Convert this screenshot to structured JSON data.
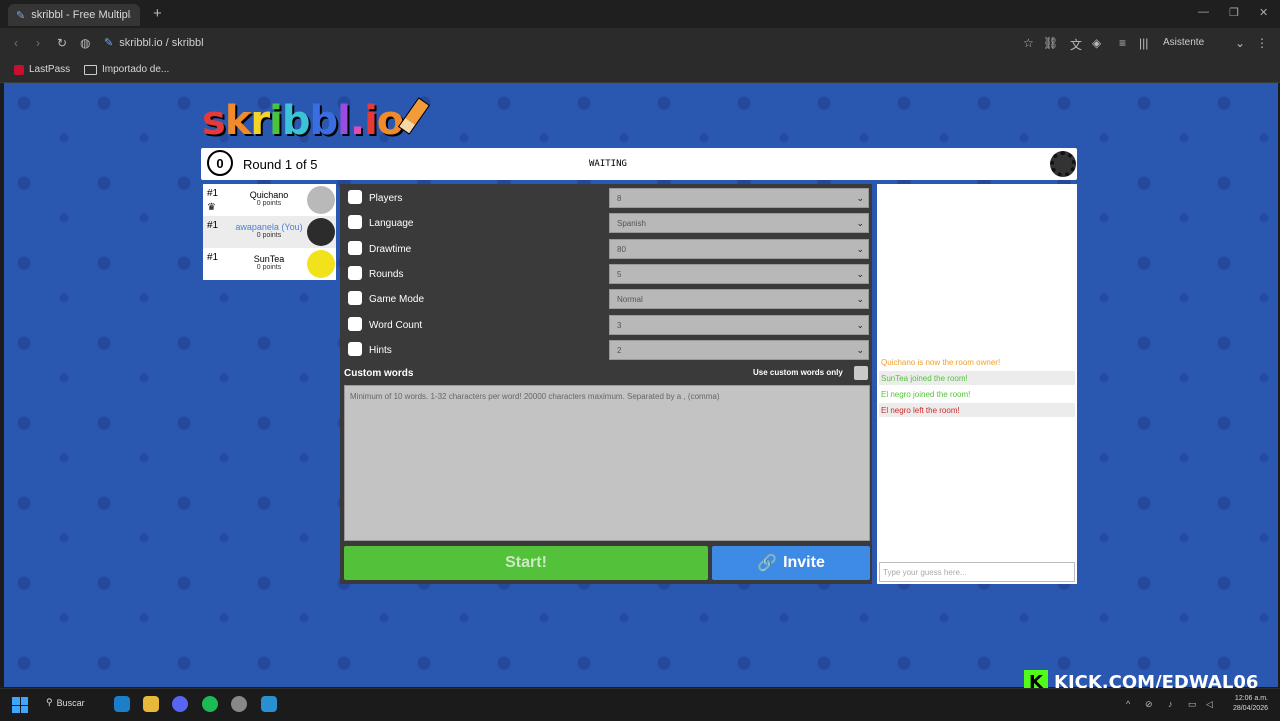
{
  "browser": {
    "tab_title": "skribbl - Free Multiplayer D",
    "url": "skribbl.io / skribbl",
    "assistant_label": "Asistente",
    "bookmarks": [
      "LastPass",
      "Importado de..."
    ]
  },
  "game": {
    "logo": "skribbl.io",
    "timer": "0",
    "round": "Round 1 of 5",
    "status": "WAITING",
    "players": [
      {
        "rank": "#1",
        "name": "Quichano",
        "points": "0 points",
        "avatar_color": "#b9b9b9",
        "owner": true
      },
      {
        "rank": "#1",
        "name": "awapanela (You)",
        "points": "0 points",
        "avatar_color": "#2c2c2c",
        "owner": false
      },
      {
        "rank": "#1",
        "name": "SunTea",
        "points": "0 points",
        "avatar_color": "#f1e21c",
        "owner": false
      }
    ],
    "settings": [
      {
        "label": "Players",
        "value": "8",
        "icon": "player-icon"
      },
      {
        "label": "Language",
        "value": "Spanish",
        "icon": "language-icon"
      },
      {
        "label": "Drawtime",
        "value": "80",
        "icon": "clock-icon"
      },
      {
        "label": "Rounds",
        "value": "5",
        "icon": "rounds-icon"
      },
      {
        "label": "Game Mode",
        "value": "Normal",
        "icon": "gamemode-icon"
      },
      {
        "label": "Word Count",
        "value": "3",
        "icon": "wordcount-icon"
      },
      {
        "label": "Hints",
        "value": "2",
        "icon": "hint-icon"
      }
    ],
    "custom_words_label": "Custom words",
    "custom_words_only_label": "Use custom words only",
    "custom_words_placeholder": "Minimum of 10 words. 1-32 characters per word! 20000 characters maximum. Separated by a , (comma)",
    "start_label": "Start!",
    "invite_label": "Invite"
  },
  "chat": {
    "messages": [
      {
        "text": "Quichano is now the room owner!",
        "color": "#f0a030",
        "bg": "#ffffff"
      },
      {
        "text": "SunTea joined the room!",
        "color": "#55c43a",
        "bg": "#ececec"
      },
      {
        "text": "El negro joined the room!",
        "color": "#55c43a",
        "bg": "#ffffff"
      },
      {
        "text": "El negro left the room!",
        "color": "#d02a2a",
        "bg": "#ececec"
      }
    ],
    "guess_placeholder": "Type your guess here..."
  },
  "overlay": {
    "kick": "KICK.COM/EDWAL06"
  },
  "taskbar": {
    "search": "Buscar",
    "time": "12:06 a.m.",
    "date": "28/04/2026"
  }
}
